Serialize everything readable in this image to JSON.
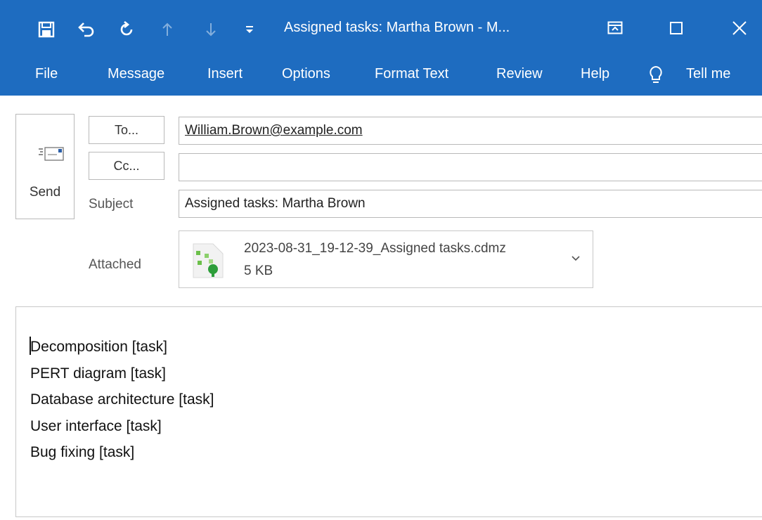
{
  "window": {
    "title": "Assigned tasks: Martha Brown  -  M..."
  },
  "quick_access": [
    {
      "name": "save-icon"
    },
    {
      "name": "undo-icon"
    },
    {
      "name": "redo-icon"
    },
    {
      "name": "up-arrow-icon"
    },
    {
      "name": "down-arrow-icon"
    },
    {
      "name": "customize-qat-icon"
    }
  ],
  "ribbon": {
    "tabs": [
      "File",
      "Message",
      "Insert",
      "Options",
      "Format Text",
      "Review",
      "Help"
    ],
    "tell_me": "Tell me"
  },
  "compose": {
    "send_label": "Send",
    "to_button": "To...",
    "cc_button": "Cc...",
    "to_value": "William.Brown@example.com",
    "cc_value": "",
    "subject_label": "Subject",
    "subject_value": "Assigned tasks: Martha Brown",
    "attached_label": "Attached",
    "attachment": {
      "name": "2023-08-31_19-12-39_Assigned tasks.cdmz",
      "size": "5 KB"
    }
  },
  "body": {
    "lines": [
      "Decomposition [task]",
      "PERT diagram [task]",
      "Database architecture [task]",
      "User interface [task]",
      "Bug fixing [task]"
    ]
  },
  "colors": {
    "titlebar": "#1e6cc0",
    "text": "#222222"
  }
}
